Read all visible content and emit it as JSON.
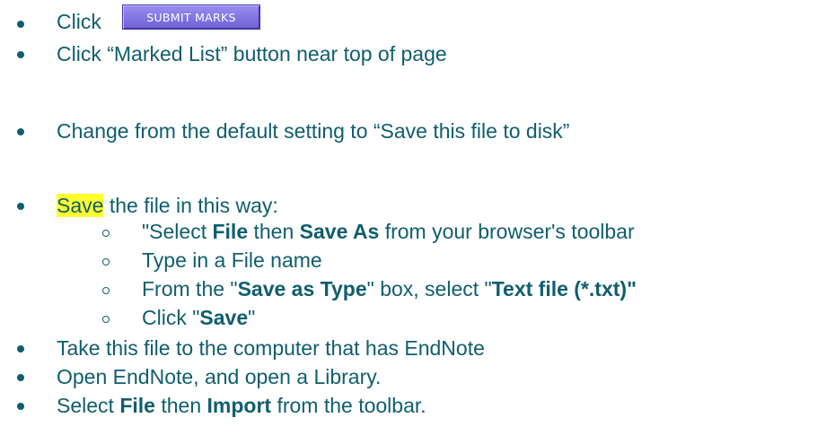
{
  "steps": {
    "s1": {
      "text": "Click",
      "button_label": "SUBMIT MARKS"
    },
    "s2": {
      "text": "Click “Marked List” button near top of page"
    },
    "s3": {
      "text": "Change from the default setting to “Save this file to disk”"
    },
    "s4": {
      "highlight": "Save",
      "rest": " the file in this way:",
      "substeps": {
        "a": {
          "p1": "\"Select ",
          "b1": "File",
          "p2": " then ",
          "b2": "Save As",
          "p3": " from your browser's toolbar"
        },
        "b": {
          "text": "Type in a File name"
        },
        "c": {
          "p1": "From the \"",
          "b1": "Save as Type",
          "p2": "\" box, select \"",
          "b2": "Text file (*.txt)\""
        },
        "d": {
          "p1": "Click \"",
          "b1": "Save",
          "p2": "\""
        }
      }
    },
    "s5": {
      "text": "Take this file to the computer that has EndNote"
    },
    "s6": {
      "text": "Open EndNote, and open a Library."
    },
    "s7": {
      "p1": "Select ",
      "b1": "File",
      "p2": " then ",
      "b2": "Import",
      "p3": " from the toolbar."
    }
  },
  "colors": {
    "text": "#0f5e6e",
    "highlight": "#ffff2e",
    "button": "#7a6be0"
  }
}
